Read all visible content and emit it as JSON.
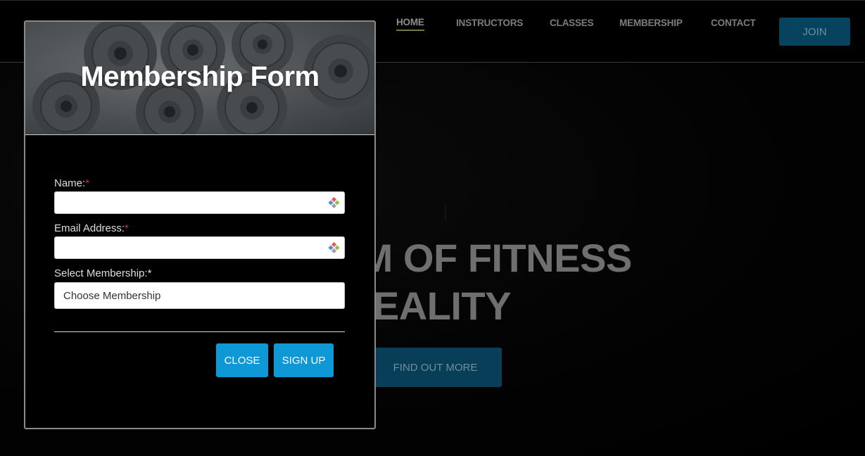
{
  "nav": {
    "items": [
      {
        "label": "HOME",
        "active": true
      },
      {
        "label": "INSTRUCTORS",
        "active": false
      },
      {
        "label": "CLASSES",
        "active": false
      },
      {
        "label": "MEMBERSHIP",
        "active": false
      },
      {
        "label": "CONTACT",
        "active": false
      }
    ],
    "join_label": "JOIN"
  },
  "hero": {
    "line1": "DREAM OF FITNESS",
    "line2": "MES REALITY",
    "cta_label": "FIND OUT MORE"
  },
  "modal": {
    "title": "Membership Form",
    "fields": {
      "name_label": "Name:",
      "name_value": "",
      "email_label": "Email Address:",
      "email_value": "",
      "membership_label": "Select Membership:",
      "membership_selected": "Choose Membership"
    },
    "required_mark": "*",
    "close_label": "CLOSE",
    "signup_label": "SIGN UP"
  },
  "colors": {
    "primary_button": "#0f98d6",
    "join_button": "#07425f",
    "required_mark": "#c0392b",
    "active_underline": "#6c7d48"
  },
  "icons": {
    "autofill": "password-manager-autofill-icon"
  }
}
